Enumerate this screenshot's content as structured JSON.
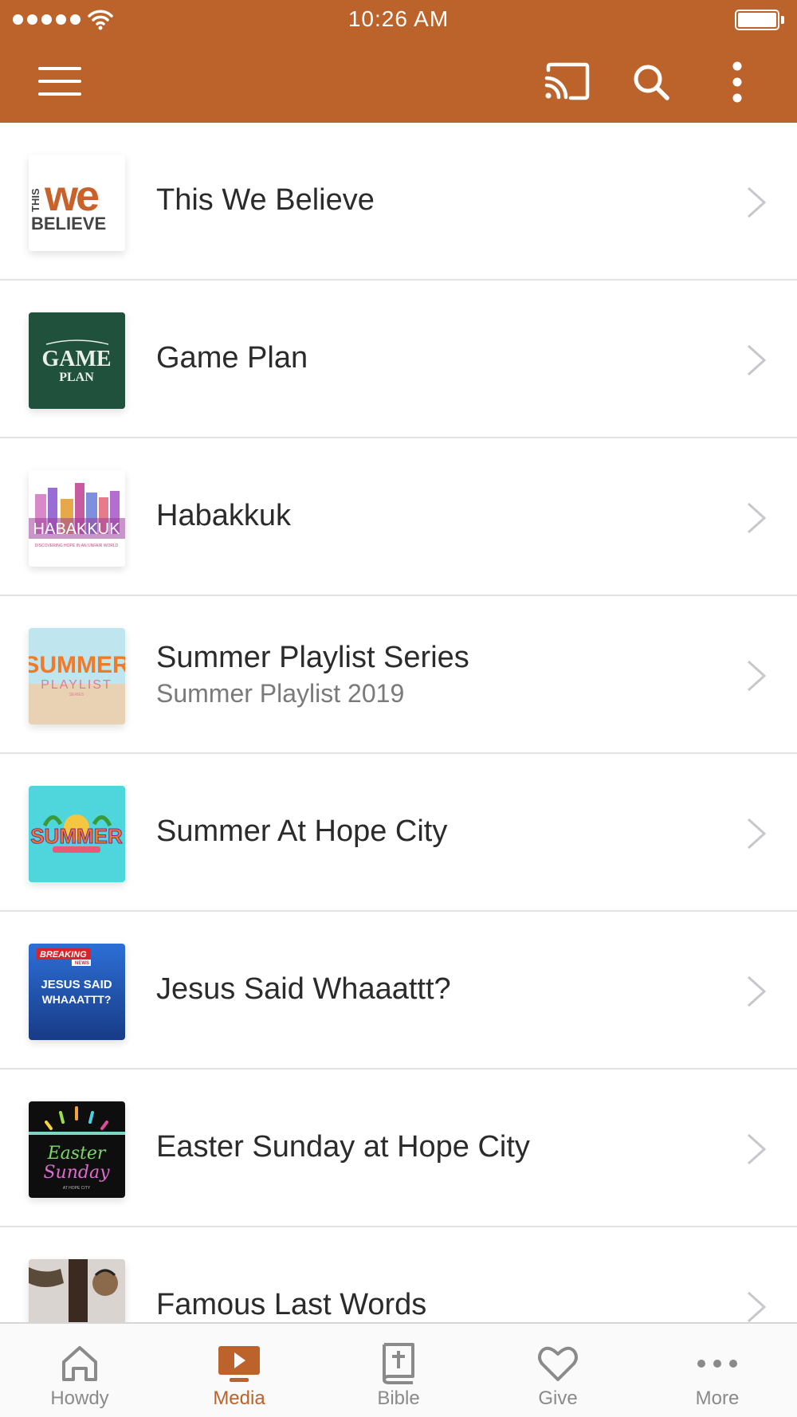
{
  "colors": {
    "brand": "#bc622b",
    "tab_inactive": "#8a8a8a",
    "divider": "#e3e3e3"
  },
  "status_bar": {
    "time": "10:26 AM",
    "signal_dots": 5
  },
  "header": {
    "icons": [
      "hamburger-menu-icon",
      "cast-icon",
      "search-icon",
      "more-vertical-icon"
    ]
  },
  "media_list": {
    "items": [
      {
        "title": "This We Believe",
        "subtitle": "",
        "thumb_text": [
          "THIS",
          "we",
          "BELIEVE"
        ]
      },
      {
        "title": "Game Plan",
        "subtitle": "",
        "thumb_text": [
          "GAME",
          "PLAN"
        ]
      },
      {
        "title": "Habakkuk",
        "subtitle": "",
        "thumb_text": [
          "HABAKKUK",
          "DISCOVERING HOPE IN AN UNFAIR WORLD"
        ]
      },
      {
        "title": "Summer Playlist Series",
        "subtitle": "Summer Playlist 2019",
        "thumb_text": [
          "SUMMER",
          "PLAYLIST",
          "SERIES"
        ]
      },
      {
        "title": "Summer At Hope City",
        "subtitle": "",
        "thumb_text": [
          "SUMMER"
        ]
      },
      {
        "title": "Jesus Said Whaaattt?",
        "subtitle": "",
        "thumb_text": [
          "BREAKING",
          "NEWS",
          "JESUS SAID",
          "WHAAATTT?"
        ]
      },
      {
        "title": "Easter Sunday at Hope City",
        "subtitle": "",
        "thumb_text": [
          "Easter",
          "Sunday",
          "AT HOPE CITY"
        ]
      },
      {
        "title": "Famous Last Words",
        "subtitle": "",
        "thumb_text": []
      }
    ]
  },
  "tab_bar": {
    "active_index": 1,
    "tabs": [
      {
        "label": "Howdy",
        "icon": "home-icon"
      },
      {
        "label": "Media",
        "icon": "media-play-icon"
      },
      {
        "label": "Bible",
        "icon": "bible-icon"
      },
      {
        "label": "Give",
        "icon": "heart-icon"
      },
      {
        "label": "More",
        "icon": "more-horizontal-icon"
      }
    ]
  }
}
